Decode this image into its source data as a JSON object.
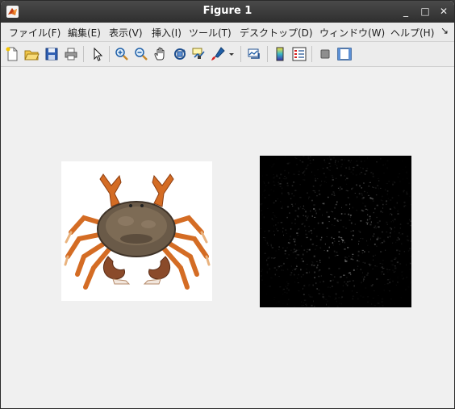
{
  "window": {
    "title": "Figure 1",
    "buttons": {
      "minimize": "_",
      "maximize": "□",
      "close": "✕"
    }
  },
  "menubar": {
    "items": [
      "ファイル(F)",
      "編集(E)",
      "表示(V)",
      "挿入(I)",
      "ツール(T)",
      "デスクトップ(D)",
      "ウィンドウ(W)",
      "ヘルプ(H)"
    ],
    "overflow": "↘"
  },
  "toolbar": {
    "icons": [
      "new-figure-icon",
      "open-file-icon",
      "save-icon",
      "print-icon",
      "pointer-icon",
      "zoom-in-icon",
      "zoom-out-icon",
      "pan-hand-icon",
      "rotate-3d-icon",
      "data-cursor-icon",
      "brush-icon",
      "dropdown-arrow-icon",
      "link-plot-icon",
      "colorbar-icon",
      "legend-icon",
      "hide-plot-tools-icon",
      "show-plot-tools-icon"
    ]
  },
  "figure": {
    "subplots": [
      {
        "content": "crab-photo",
        "background": "#ffffff"
      },
      {
        "content": "magnitude-image",
        "background": "#000000"
      }
    ]
  },
  "colors": {
    "titlebar": "#333333",
    "figure_bg": "#f0f0f0",
    "crab_shell": "#6a5a48",
    "crab_legs": "#d9772e"
  }
}
